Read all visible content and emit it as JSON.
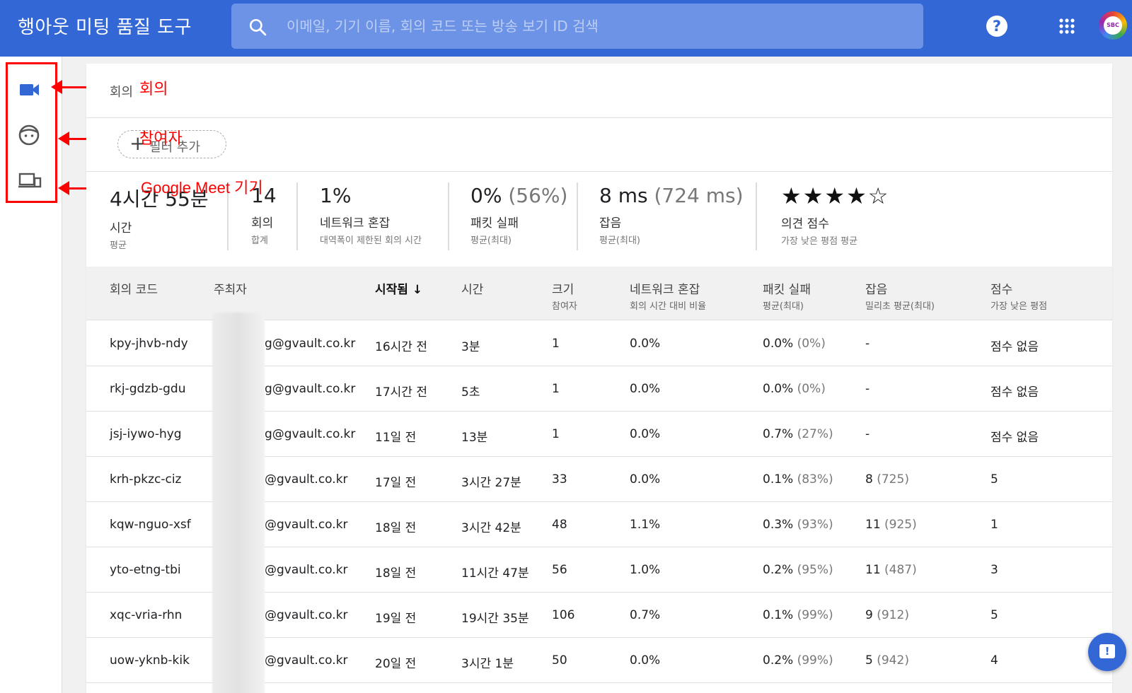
{
  "header": {
    "title": "행아웃 미팅 품질 도구",
    "search_placeholder": "이메일, 기기 이름, 회의 코드 또는 방송 보기 ID 검색",
    "help_glyph": "?",
    "avatar_text": "SBC"
  },
  "sidebar": {
    "items": [
      {
        "name": "meetings",
        "icon": "video-camera-icon"
      },
      {
        "name": "participants",
        "icon": "face-icon"
      },
      {
        "name": "devices",
        "icon": "devices-icon"
      }
    ]
  },
  "annotations": {
    "meetings": "회의",
    "participants": "참여자",
    "devices": "Google Meet 기기",
    "color": "#ff0000"
  },
  "breadcrumb": "회의",
  "filter": {
    "plus": "+",
    "label": "필터 추가"
  },
  "stats": [
    {
      "value": "4시간 55분",
      "sub": "",
      "label": "시간",
      "caption": "평균"
    },
    {
      "value": "14",
      "sub": "",
      "label": "회의",
      "caption": "합계"
    },
    {
      "value": "1%",
      "sub": "",
      "label": "네트워크 혼잡",
      "caption": "대역폭이 제한된 회의 시간"
    },
    {
      "value": "0%",
      "sub": "(56%)",
      "label": "패킷 실패",
      "caption": "평균(최대)"
    },
    {
      "value": "8 ms",
      "sub": "(724 ms)",
      "label": "잡음",
      "caption": "평균(최대)"
    },
    {
      "stars": "★★★★☆",
      "rating": 4,
      "label": "의견 점수",
      "caption": "가장 낮은 평점 평균"
    }
  ],
  "table": {
    "columns": [
      {
        "label": "회의 코드",
        "caption": ""
      },
      {
        "label": "주최자",
        "caption": ""
      },
      {
        "label": "시작됨",
        "caption": "",
        "sort": "↓"
      },
      {
        "label": "시간",
        "caption": ""
      },
      {
        "label": "크기",
        "caption": "참여자"
      },
      {
        "label": "네트워크 혼잡",
        "caption": "회의 시간 대비 비율"
      },
      {
        "label": "패킷 실패",
        "caption": "평균(최대)"
      },
      {
        "label": "잡음",
        "caption": "밀리초 평균(최대)"
      },
      {
        "label": "점수",
        "caption": "가장 낮은 평점"
      }
    ],
    "rows": [
      {
        "code": "kpy-jhvb-ndy",
        "host": "g@gvault.co.kr",
        "started": "16시간 전",
        "duration": "3분",
        "size": "1",
        "congestion": "0.0%",
        "packet": "0.0%",
        "packet_max": "(0%)",
        "jitter": "-",
        "jitter_max": "",
        "score": "점수 없음"
      },
      {
        "code": "rkj-gdzb-gdu",
        "host": "g@gvault.co.kr",
        "started": "17시간 전",
        "duration": "5초",
        "size": "1",
        "congestion": "0.0%",
        "packet": "0.0%",
        "packet_max": "(0%)",
        "jitter": "-",
        "jitter_max": "",
        "score": "점수 없음"
      },
      {
        "code": "jsj-iywo-hyg",
        "host": "g@gvault.co.kr",
        "started": "11일 전",
        "duration": "13분",
        "size": "1",
        "congestion": "0.0%",
        "packet": "0.7%",
        "packet_max": "(27%)",
        "jitter": "-",
        "jitter_max": "",
        "score": "점수 없음"
      },
      {
        "code": "krh-pkzc-ciz",
        "host": "@gvault.co.kr",
        "started": "17일 전",
        "duration": "3시간 27분",
        "size": "33",
        "congestion": "0.0%",
        "packet": "0.1%",
        "packet_max": "(83%)",
        "jitter": "8",
        "jitter_max": "(725)",
        "score": "5"
      },
      {
        "code": "kqw-nguo-xsf",
        "host": "@gvault.co.kr",
        "started": "18일 전",
        "duration": "3시간 42분",
        "size": "48",
        "congestion": "1.1%",
        "packet": "0.3%",
        "packet_max": "(93%)",
        "jitter": "11",
        "jitter_max": "(925)",
        "score": "1"
      },
      {
        "code": "yto-etng-tbi",
        "host": "@gvault.co.kr",
        "started": "18일 전",
        "duration": "11시간 47분",
        "size": "56",
        "congestion": "1.0%",
        "packet": "0.2%",
        "packet_max": "(95%)",
        "jitter": "11",
        "jitter_max": "(487)",
        "score": "3"
      },
      {
        "code": "xqc-vria-rhn",
        "host": "@gvault.co.kr",
        "started": "19일 전",
        "duration": "19시간 35분",
        "size": "106",
        "congestion": "0.7%",
        "packet": "0.1%",
        "packet_max": "(99%)",
        "jitter": "9",
        "jitter_max": "(912)",
        "score": "5"
      },
      {
        "code": "uow-yknb-kik",
        "host": "@gvault.co.kr",
        "started": "20일 전",
        "duration": "3시간 1분",
        "size": "50",
        "congestion": "0.0%",
        "packet": "0.2%",
        "packet_max": "(99%)",
        "jitter": "5",
        "jitter_max": "(942)",
        "score": "4"
      }
    ]
  },
  "colors": {
    "header_bg": "#3367d6",
    "search_bg": "#6d93e6",
    "accent": "#3367d6"
  },
  "fab_icon": "feedback-icon"
}
